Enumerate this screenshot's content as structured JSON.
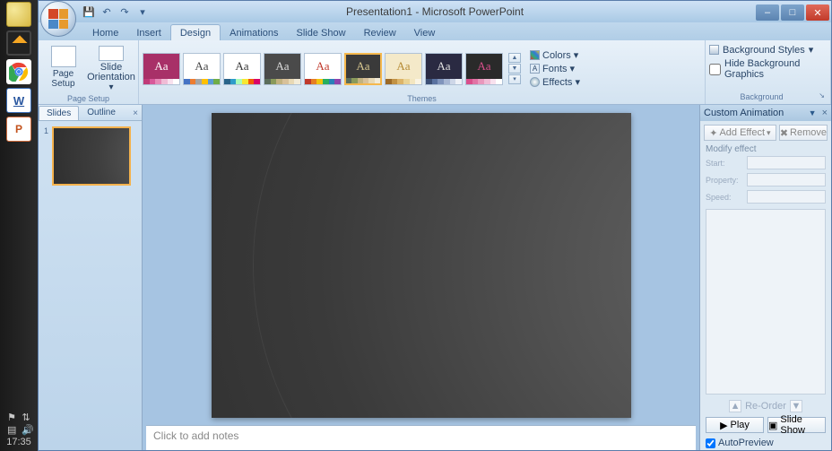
{
  "taskbar": {
    "time": "17:35",
    "tooltip_word": "W",
    "tooltip_pp": "P"
  },
  "titlebar": {
    "title": "Presentation1 - Microsoft PowerPoint"
  },
  "tabs": {
    "items": [
      "Home",
      "Insert",
      "Design",
      "Animations",
      "Slide Show",
      "Review",
      "View"
    ],
    "active_index": 2
  },
  "ribbon": {
    "page_setup": {
      "page_setup_btn": "Page\nSetup",
      "orientation_btn": "Slide\nOrientation",
      "group_label": "Page Setup"
    },
    "themes": {
      "group_label": "Themes",
      "items": [
        {
          "aa_color": "#ffffff",
          "bg": "#a83068",
          "bar": [
            "#c03a78",
            "#d8589a",
            "#e78ab8",
            "#f0bcd6",
            "#f8e1ee",
            "#fff"
          ]
        },
        {
          "aa_color": "#444",
          "bg": "#ffffff",
          "bar": [
            "#4472c4",
            "#ed7d31",
            "#a5a5a5",
            "#ffc000",
            "#5b9bd5",
            "#70ad47"
          ]
        },
        {
          "aa_color": "#333",
          "bg": "#ffffff",
          "bar": [
            "#29648a",
            "#2e9cca",
            "#aafcb8",
            "#f7e733",
            "#f25c05",
            "#d90368"
          ]
        },
        {
          "aa_color": "#ddd",
          "bg": "#4a4a4a",
          "bar": [
            "#5b6d5b",
            "#8a9a5b",
            "#c2b280",
            "#d8c19a",
            "#e8d9b5",
            "#f2ebd8"
          ]
        },
        {
          "aa_color": "#c0392b",
          "bg": "#ffffff",
          "bar": [
            "#c0392b",
            "#e67e22",
            "#f1c40f",
            "#27ae60",
            "#2980b9",
            "#8e44ad"
          ]
        },
        {
          "aa_color": "#d8c890",
          "bg": "#3a3a3a",
          "bar": [
            "#5b6d5b",
            "#8a9a5b",
            "#c2b280",
            "#d8c19a",
            "#e8d9b5",
            "#f2ebd8"
          ],
          "special": "selected"
        },
        {
          "aa_color": "#b58a34",
          "bg": "#f4e9c9",
          "bar": [
            "#9c6a28",
            "#c29244",
            "#dcb469",
            "#ead394",
            "#f3e6c0",
            "#faf4e3"
          ]
        },
        {
          "aa_color": "#e0e0e0",
          "bg": "#2a2a42",
          "bar": [
            "#3c4f76",
            "#5a72a0",
            "#8094bc",
            "#a7b6d3",
            "#ced7e8",
            "#eef1f7"
          ]
        },
        {
          "aa_color": "#d94f8c",
          "bg": "#2a2a2a",
          "bar": [
            "#d94f8c",
            "#e173a5",
            "#e998bd",
            "#f0bcd6",
            "#f8e1ee",
            "#fff"
          ]
        }
      ],
      "right_list": {
        "colors": "Colors",
        "fonts": "Fonts",
        "effects": "Effects"
      }
    },
    "background": {
      "styles": "Background Styles",
      "hide": "Hide Background Graphics",
      "group_label": "Background"
    }
  },
  "slides_panel": {
    "tab_slides": "Slides",
    "tab_outline": "Outline",
    "thumb_number": "1"
  },
  "notes": {
    "placeholder": "Click to add notes"
  },
  "anim_pane": {
    "title": "Custom Animation",
    "add_effect": "Add Effect",
    "remove": "Remove",
    "modify": "Modify effect",
    "start": "Start:",
    "property": "Property:",
    "speed": "Speed:",
    "reorder": "Re-Order",
    "play": "Play",
    "slideshow": "Slide Show",
    "autopreview": "AutoPreview"
  }
}
